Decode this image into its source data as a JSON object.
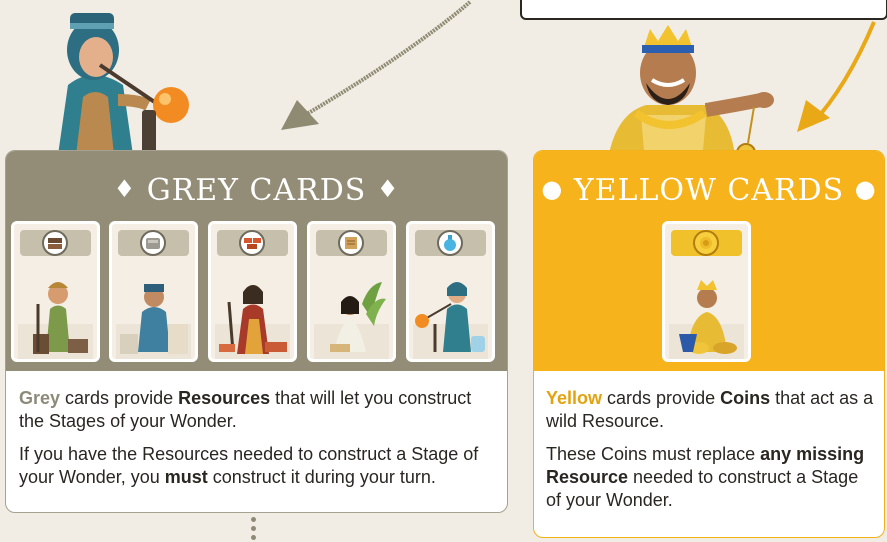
{
  "grey": {
    "title": "GREY CARDS",
    "title_glyph": "♦",
    "body_lead_highlight": "Grey",
    "body_lead_rest": " cards provide ",
    "body_lead_bold": "Resources",
    "body_lead_tail": " that will let you construct the Stages of your Wonder.",
    "body_second_start": "If you have the Resources needed to construct a Stage of your Wonder, you ",
    "body_second_bold": "must",
    "body_second_end": " construct it during your turn.",
    "cards": [
      {
        "resource": "wood-icon"
      },
      {
        "resource": "stone-icon"
      },
      {
        "resource": "brick-icon"
      },
      {
        "resource": "papyrus-icon"
      },
      {
        "resource": "glass-icon"
      }
    ]
  },
  "yellow": {
    "title": "YELLOW CARDS",
    "title_glyph": "●",
    "body_lead_highlight": "Yellow",
    "body_lead_rest": " cards provide ",
    "body_lead_bold": "Coins",
    "body_lead_tail": " that act as a wild Resource.",
    "body_second_start": "These Coins must replace ",
    "body_second_bold": "any missing Resource",
    "body_second_end": " needed to construct a Stage of your Wonder.",
    "card": {
      "resource": "coin-icon"
    }
  },
  "colors": {
    "grey_panel": "#938d77",
    "yellow_panel": "#f6b31b",
    "grey_text": "#8d8a79",
    "yellow_text": "#e3a311"
  }
}
